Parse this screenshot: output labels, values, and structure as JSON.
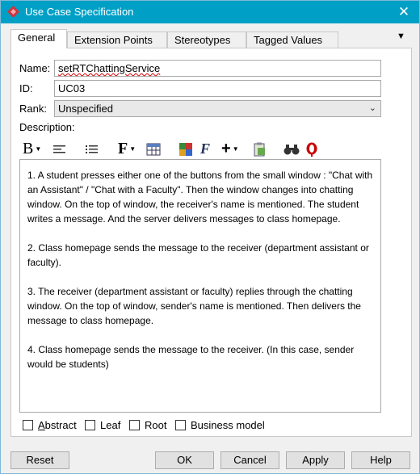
{
  "window": {
    "title": "Use Case Specification",
    "close_glyph": "✕"
  },
  "tabs": [
    "General",
    "Extension Points",
    "Stereotypes",
    "Tagged Values"
  ],
  "tab_menu_glyph": "▼",
  "form": {
    "name_label": "Name:",
    "name_value": "setRTChattingService",
    "id_label": "ID:",
    "id_value": "UC03",
    "rank_label": "Rank:",
    "rank_value": "Unspecified",
    "description_label": "Description:"
  },
  "toolbar": {
    "bold": "B",
    "font": "F",
    "plus": "+",
    "icons": [
      "bold-icon",
      "align-icon",
      "list-icon",
      "font-icon",
      "table-icon",
      "color-icon",
      "format-icon",
      "insert-icon",
      "paste-icon",
      "find-icon",
      "spell-icon"
    ]
  },
  "description": "1. A student presses either one of the buttons from the small window : \"Chat with an Assistant\" / \"Chat with a Faculty\". Then the window changes into chatting window. On the top of window, the receiver's name is mentioned. The student writes a message. And the server delivers messages to class homepage.\n\n2. Class homepage sends the message to the receiver (department assistant or faculty).\n\n3. The receiver (department assistant or faculty) replies through the chatting window. On the top of window, sender's name is mentioned. Then delivers the message to class homepage.\n\n4. Class homepage sends the message to the receiver. (In this case, sender would be students)",
  "checkboxes": [
    "Abstract",
    "Leaf",
    "Root",
    "Business model"
  ],
  "buttons": {
    "reset": "Reset",
    "ok": "OK",
    "cancel": "Cancel",
    "apply": "Apply",
    "help": "Help"
  },
  "colors": {
    "titlebar": "#00a0c6",
    "app_icon": "#d0343a"
  }
}
